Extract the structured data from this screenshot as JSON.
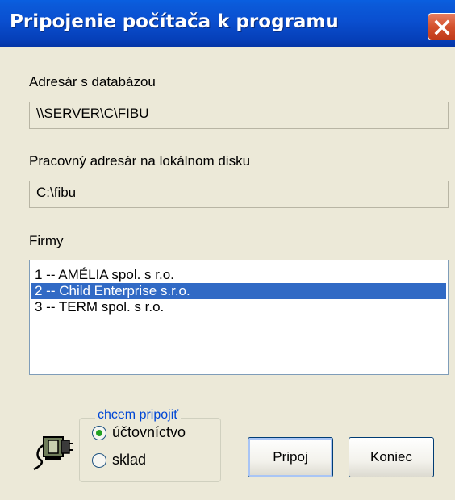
{
  "window": {
    "title": "Pripojenie počítača k programu",
    "title_icon": "close-icon"
  },
  "database_dir": {
    "label": "Adresár s databázou",
    "value": "\\\\SERVER\\C\\FIBU"
  },
  "local_dir": {
    "label": "Pracovný adresár na lokálnom disku",
    "value": "C:\\fibu"
  },
  "companies": {
    "label": "Firmy",
    "items": [
      "1 -- AMÉLIA spol. s r.o.",
      "2 -- Child Enterprise s.r.o.",
      "3 -- TERM spol. s r.o."
    ],
    "selected_index": 1
  },
  "connect_group": {
    "legend": "chcem pripojiť",
    "options": [
      "účtovníctvo",
      "sklad"
    ],
    "selected": "účtovníctvo"
  },
  "buttons": {
    "connect": "Pripoj",
    "close": "Koniec"
  },
  "colors": {
    "titlebar": "#0a4fd0",
    "selection": "#316ac5",
    "dialog_bg": "#ece9d8",
    "legend_text": "#0046d5"
  },
  "icons": {
    "connection": "plug-cable-icon"
  }
}
